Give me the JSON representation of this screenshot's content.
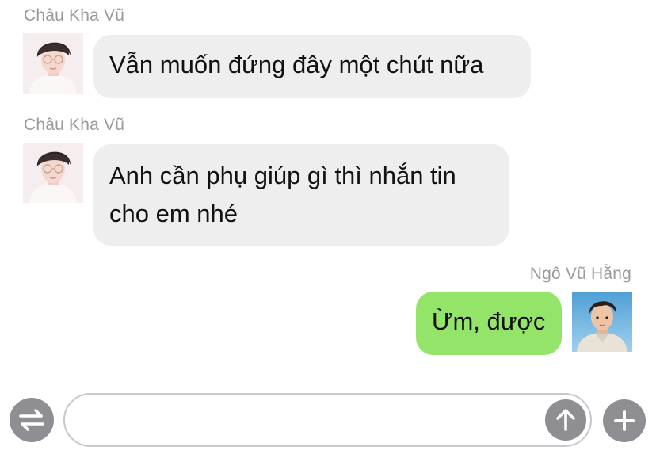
{
  "conversation": {
    "messages": [
      {
        "sender": "Châu Kha Vũ",
        "direction": "incoming",
        "lines": [
          "Vẫn muốn đứng đây một chút nữa"
        ]
      },
      {
        "sender": "Châu Kha Vũ",
        "direction": "incoming",
        "lines": [
          "Anh cần phụ giúp gì thì nhắn tin",
          "cho em nhé"
        ]
      },
      {
        "sender": "Ngô Vũ Hằng",
        "direction": "outgoing",
        "lines": [
          "Ừm, được"
        ]
      }
    ]
  },
  "composer": {
    "input_value": "",
    "input_placeholder": "",
    "switch_icon": "swap-arrows-icon",
    "send_icon": "arrow-up-icon",
    "add_icon": "plus-icon"
  },
  "colors": {
    "incoming_bubble": "#eeeeef",
    "outgoing_bubble": "#95e46a",
    "sender_name": "#9a9a9e",
    "icon_button": "#8e8e93"
  }
}
